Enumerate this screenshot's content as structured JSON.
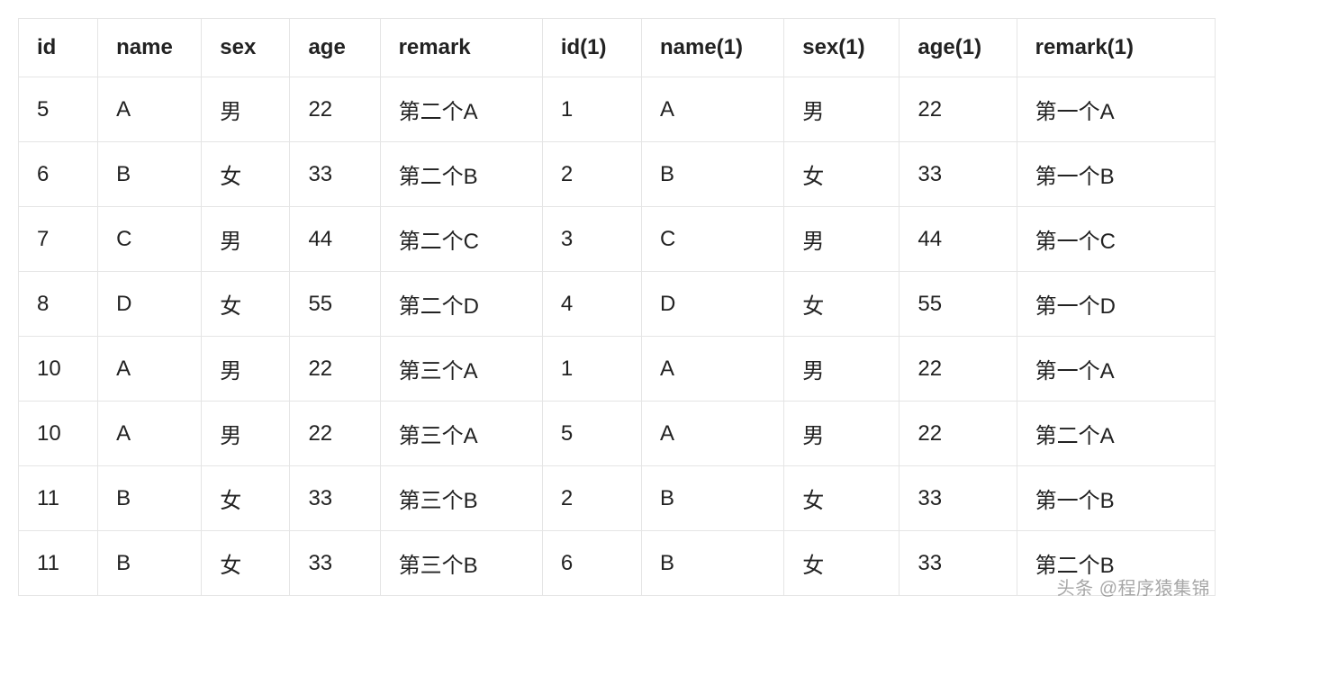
{
  "table": {
    "headers": [
      "id",
      "name",
      "sex",
      "age",
      "remark",
      "id(1)",
      "name(1)",
      "sex(1)",
      "age(1)",
      "remark(1)"
    ],
    "rows": [
      [
        "5",
        "A",
        "男",
        "22",
        "第二个A",
        "1",
        "A",
        "男",
        "22",
        "第一个A"
      ],
      [
        "6",
        "B",
        "女",
        "33",
        "第二个B",
        "2",
        "B",
        "女",
        "33",
        "第一个B"
      ],
      [
        "7",
        "C",
        "男",
        "44",
        "第二个C",
        "3",
        "C",
        "男",
        "44",
        "第一个C"
      ],
      [
        "8",
        "D",
        "女",
        "55",
        "第二个D",
        "4",
        "D",
        "女",
        "55",
        "第一个D"
      ],
      [
        "10",
        "A",
        "男",
        "22",
        "第三个A",
        "1",
        "A",
        "男",
        "22",
        "第一个A"
      ],
      [
        "10",
        "A",
        "男",
        "22",
        "第三个A",
        "5",
        "A",
        "男",
        "22",
        "第二个A"
      ],
      [
        "11",
        "B",
        "女",
        "33",
        "第三个B",
        "2",
        "B",
        "女",
        "33",
        "第一个B"
      ],
      [
        "11",
        "B",
        "女",
        "33",
        "第三个B",
        "6",
        "B",
        "女",
        "33",
        "第二个B"
      ]
    ]
  },
  "watermark": "头条 @程序猿集锦"
}
